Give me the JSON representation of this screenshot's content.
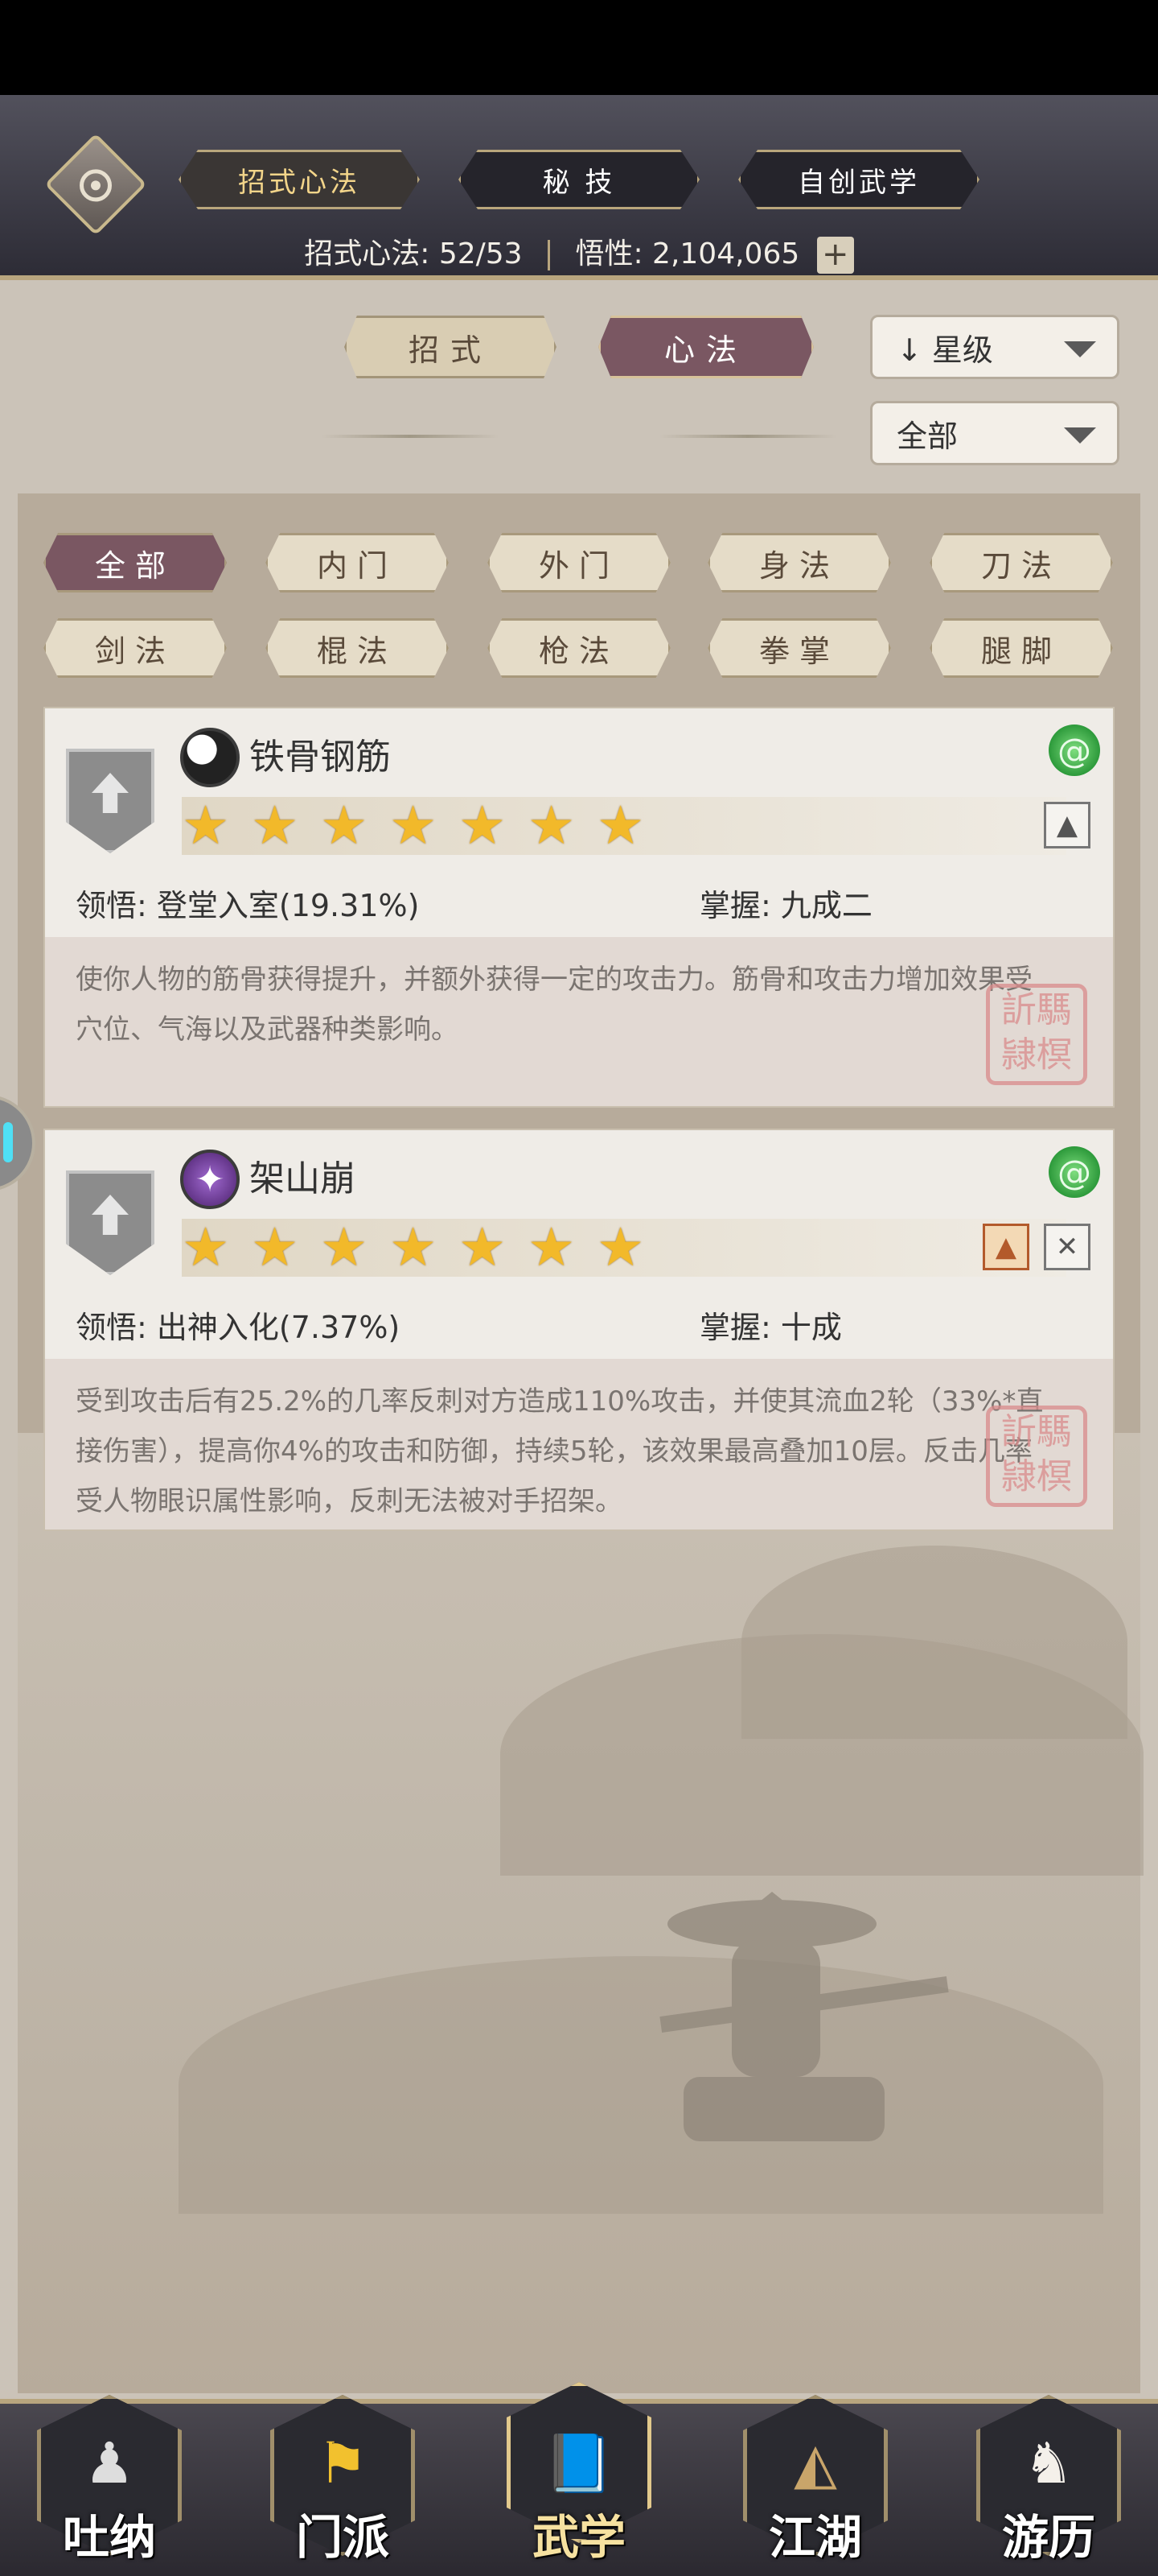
{
  "header": {
    "tabs": [
      {
        "label": "招式心法",
        "active": true
      },
      {
        "label": "秘 技",
        "active": false
      },
      {
        "label": "自创武学",
        "active": false
      }
    ],
    "stats": {
      "moves_label": "招式心法: 52/53",
      "comprehension_label": "悟性: 2,104,065",
      "plus": "+"
    }
  },
  "controls": {
    "type_tabs": [
      {
        "label": "招式",
        "active": false
      },
      {
        "label": "心法",
        "active": true
      }
    ],
    "sort": {
      "value": "↓ 星级"
    },
    "scope": {
      "value": "全部"
    }
  },
  "filters": [
    {
      "label": "全部",
      "active": true
    },
    {
      "label": "内门",
      "active": false
    },
    {
      "label": "外门",
      "active": false
    },
    {
      "label": "身法",
      "active": false
    },
    {
      "label": "刀法",
      "active": false
    },
    {
      "label": "剑法",
      "active": false
    },
    {
      "label": "棍法",
      "active": false
    },
    {
      "label": "枪法",
      "active": false
    },
    {
      "label": "拳掌",
      "active": false
    },
    {
      "label": "腿脚",
      "active": false
    }
  ],
  "skills": [
    {
      "name": "铁骨钢筋",
      "stars": 7,
      "comprehension": "领悟: 登堂入室(19.31%)",
      "mastery": "掌握: 九成二",
      "description": "使你人物的筋骨获得提升，并额外获得一定的攻击力。筋骨和攻击力增加效果受穴位、气海以及武器种类影响。",
      "seal": "訢 𨽻 騳 榠"
    },
    {
      "name": "架山崩",
      "stars": 7,
      "comprehension": "领悟: 出神入化(7.37%)",
      "mastery": "掌握: 十成",
      "description": "受到攻击后有25.2%的几率反刺对方造成110%攻击，并使其流血2轮（33%*直接伤害），提高你4%的攻击和防御，持续5轮，该效果最高叠加10层。反击几率受人物眼识属性影响，反刺无法被对手招架。",
      "seal": "訢 𨽻 騳 榠"
    }
  ],
  "bottom_nav": [
    {
      "label": "吐纳",
      "active": false
    },
    {
      "label": "门派",
      "active": false
    },
    {
      "label": "武学",
      "active": true
    },
    {
      "label": "江湖",
      "active": false
    },
    {
      "label": "游历",
      "active": false
    }
  ]
}
